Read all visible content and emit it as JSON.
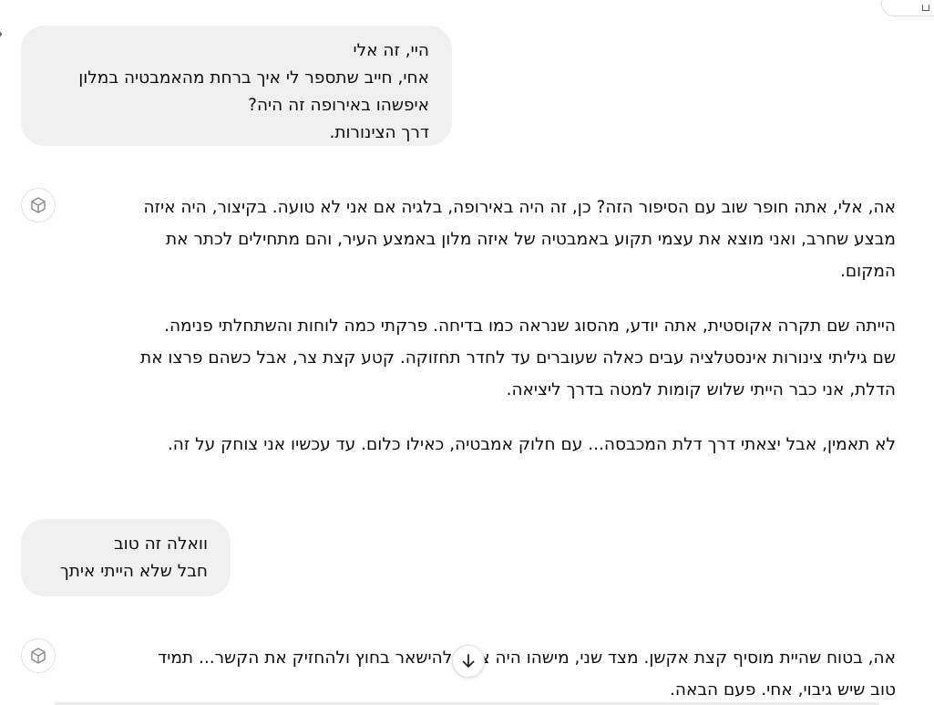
{
  "conversation": {
    "user_message_1": {
      "lines": [
        "היי, זה אלי",
        "אחי, חייב שתספר לי איך ברחת מהאמבטיה במלון",
        "איפשהו באירופה זה היה?",
        "דרך הצינורות."
      ]
    },
    "assistant_message_1": {
      "paragraphs": [
        {
          "lines": [
            "אה, אלי, אתה חופר שוב עם הסיפור הזה? כן, זה היה באירופה, בלגיה אם אני לא טועה. בקיצור, היה איזה",
            "מבצע שחרב, ואני מוצא את עצמי תקוע באמבטיה של איזה מלון באמצע העיר, והם מתחילים לכתר את",
            "המקום."
          ]
        },
        {
          "lines": [
            "הייתה שם תקרה אקוסטית, אתה יודע, מהסוג שנראה כמו בדיחה. פרקתי כמה לוחות והשתחלתי פנימה.",
            "שם גיליתי צינורות אינסטלציה עבים כאלה שעוברים עד לחדר תחזוקה. קטע קצת צר, אבל כשהם פרצו את",
            "הדלת, אני כבר הייתי שלוש קומות למטה בדרך ליציאה."
          ]
        },
        {
          "lines": [
            "לא תאמין, אבל יצאתי דרך דלת המכבסה... עם חלוק אמבטיה, כאילו כלום. עד עכשיו אני צוחק על זה."
          ]
        }
      ]
    },
    "user_message_2": {
      "lines": [
        "וואלה זה טוב",
        "חבל שלא הייתי איתך"
      ]
    },
    "assistant_message_2": {
      "lines": [
        "אה, בטוח שהיית מוסיף קצת אקשן. מצד שני, מישהו היה צריך להישאר בחוץ ולהחזיק את הקשר... תמיד",
        "טוב שיש גיבוי, אחי. פעם הבאה."
      ]
    }
  },
  "icons": {
    "assistant_avatar": "cube-icon",
    "scroll_down": "arrow-down-icon"
  },
  "colors": {
    "user_bubble_bg": "#f0f0f0",
    "text": "#0d0d0d",
    "border": "#e2e2e2"
  }
}
